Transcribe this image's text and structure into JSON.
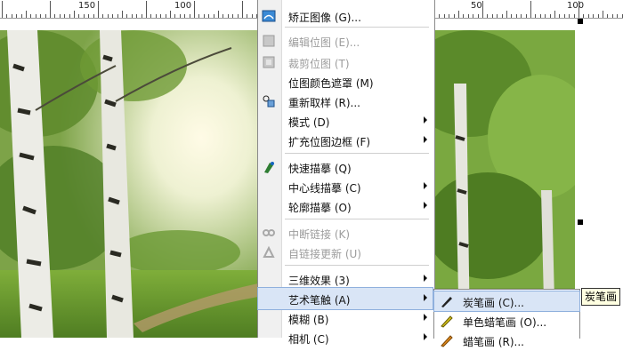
{
  "ruler": {
    "labels": [
      "150",
      "100",
      "50",
      "100"
    ]
  },
  "context_menu": {
    "items": [
      {
        "label": "矫正图像 (G)...",
        "icon": "straighten-image-icon",
        "disabled": false,
        "submenu": false
      },
      {
        "label": "编辑位图 (E)...",
        "icon": "edit-bitmap-icon",
        "disabled": true,
        "submenu": false
      },
      {
        "label": "裁剪位图 (T)",
        "icon": "crop-bitmap-icon",
        "disabled": true,
        "submenu": false
      },
      {
        "label": "位图颜色遮罩 (M)",
        "icon": "",
        "disabled": false,
        "submenu": false
      },
      {
        "label": "重新取样 (R)...",
        "icon": "resample-icon",
        "disabled": false,
        "submenu": false
      },
      {
        "label": "模式 (D)",
        "icon": "",
        "disabled": false,
        "submenu": true
      },
      {
        "label": "扩充位图边框 (F)",
        "icon": "",
        "disabled": false,
        "submenu": true
      },
      {
        "label": "快速描摹 (Q)",
        "icon": "quick-trace-icon",
        "disabled": false,
        "submenu": false
      },
      {
        "label": "中心线描摹 (C)",
        "icon": "",
        "disabled": false,
        "submenu": true
      },
      {
        "label": "轮廓描摹 (O)",
        "icon": "",
        "disabled": false,
        "submenu": true
      },
      {
        "label": "中断链接 (K)",
        "icon": "break-link-icon",
        "disabled": true,
        "submenu": false
      },
      {
        "label": "自链接更新 (U)",
        "icon": "update-link-icon",
        "disabled": true,
        "submenu": false
      },
      {
        "label": "三维效果 (3)",
        "icon": "",
        "disabled": false,
        "submenu": true
      },
      {
        "label": "艺术笔触 (A)",
        "icon": "",
        "disabled": false,
        "submenu": true,
        "selected": true
      },
      {
        "label": "模糊 (B)",
        "icon": "",
        "disabled": false,
        "submenu": true
      },
      {
        "label": "相机 (C)",
        "icon": "",
        "disabled": false,
        "submenu": true
      }
    ]
  },
  "sub_menu": {
    "items": [
      {
        "label": "炭笔画 (C)...",
        "icon": "charcoal-icon",
        "selected": true
      },
      {
        "label": "单色蜡笔画 (O)...",
        "icon": "crayon-icon",
        "selected": false
      },
      {
        "label": "蜡笔画 (R)...",
        "icon": "wax-crayon-icon",
        "selected": false
      }
    ]
  },
  "tooltip": "炭笔画",
  "colors": {
    "menu_highlight": "#d9e5f6",
    "menu_highlight_border": "#8fb0dd",
    "disabled_text": "#9c9c9c",
    "tooltip_bg": "#ffffe1"
  }
}
